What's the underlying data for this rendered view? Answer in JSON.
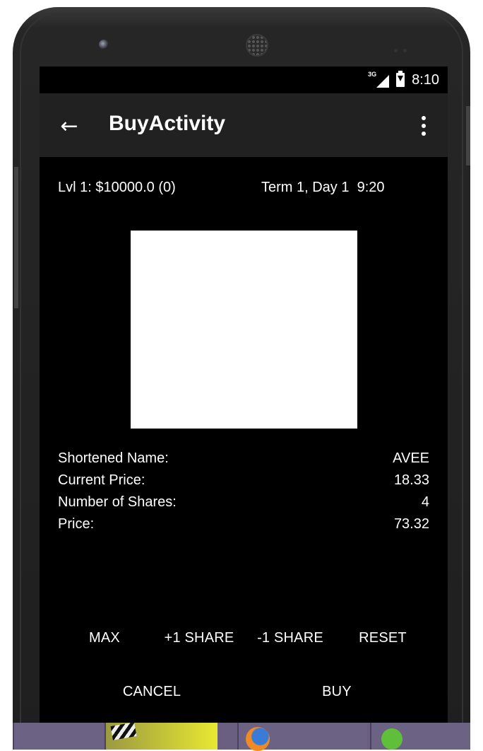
{
  "status_bar": {
    "network_label": "3G",
    "time": "8:10",
    "icons": [
      "signal-icon",
      "battery-charging-icon"
    ]
  },
  "app_bar": {
    "back_icon": "arrow-left-icon",
    "back_glyph": "←",
    "title": "BuyActivity",
    "overflow_icon": "more-vert-icon"
  },
  "info": {
    "level_balance": "Lvl 1: $10000.0 (0)",
    "term_day_time": "Term 1, Day 1  9:20"
  },
  "stock": {
    "image_color": "#ffffff",
    "details": [
      {
        "label": "Shortened Name:",
        "value": "AVEE"
      },
      {
        "label": "Current Price:",
        "value": "18.33"
      },
      {
        "label": "Number of Shares:",
        "value": "4"
      },
      {
        "label": "Price:",
        "value": "73.32"
      }
    ]
  },
  "actions": {
    "max": "MAX",
    "plus_one": "+1 SHARE",
    "minus_one": "-1 SHARE",
    "reset": "RESET"
  },
  "bottom_actions": {
    "cancel": "CANCEL",
    "buy": "BUY"
  },
  "colors": {
    "screen_bg": "#000000",
    "app_bar_bg": "#212121",
    "text": "#ffffff"
  }
}
